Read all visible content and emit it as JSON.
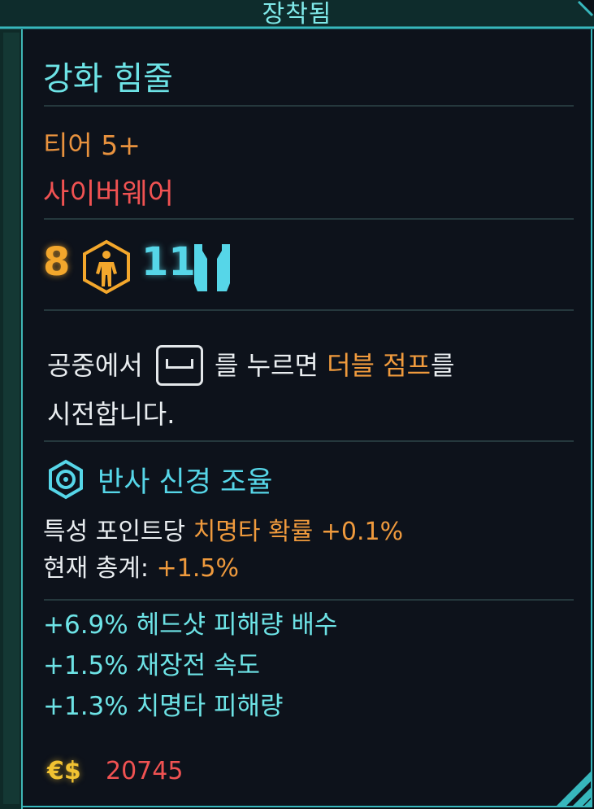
{
  "header": {
    "status": "장착됨"
  },
  "item": {
    "name": "강화 힘줄",
    "tier": "티어 5+",
    "category": "사이버웨어"
  },
  "requirements": {
    "attribute_value": "8",
    "attribute_icon": "body-attribute-icon",
    "capacity_value": "11",
    "capacity_icon": "cyberware-capacity-icon"
  },
  "description": {
    "part1": "공중에서",
    "key_icon": "jump-key-icon",
    "part2": "를 누르면",
    "highlight": "더블 점프",
    "part3": "를",
    "line2": "시전합니다."
  },
  "perk": {
    "icon": "perk-hex-icon",
    "title": "반사 신경 조율",
    "line1_prefix": "특성 포인트당",
    "line1_highlight": "치명타 확률 +0.1%",
    "line2_prefix": "현재 총계:",
    "line2_highlight": "+1.5%"
  },
  "stats": [
    "+6.9%  헤드샷 피해량 배수",
    "+1.5%  재장전 속도",
    "+1.3%  치명타 피해량"
  ],
  "price": {
    "icon": "eurodollar-icon",
    "symbol": "€$",
    "value": "20745"
  },
  "colors": {
    "accent_cyan": "#6de3e6",
    "orange": "#ef9a3d",
    "red": "#f05252",
    "gold": "#f3a72c",
    "background": "#0d121b"
  }
}
